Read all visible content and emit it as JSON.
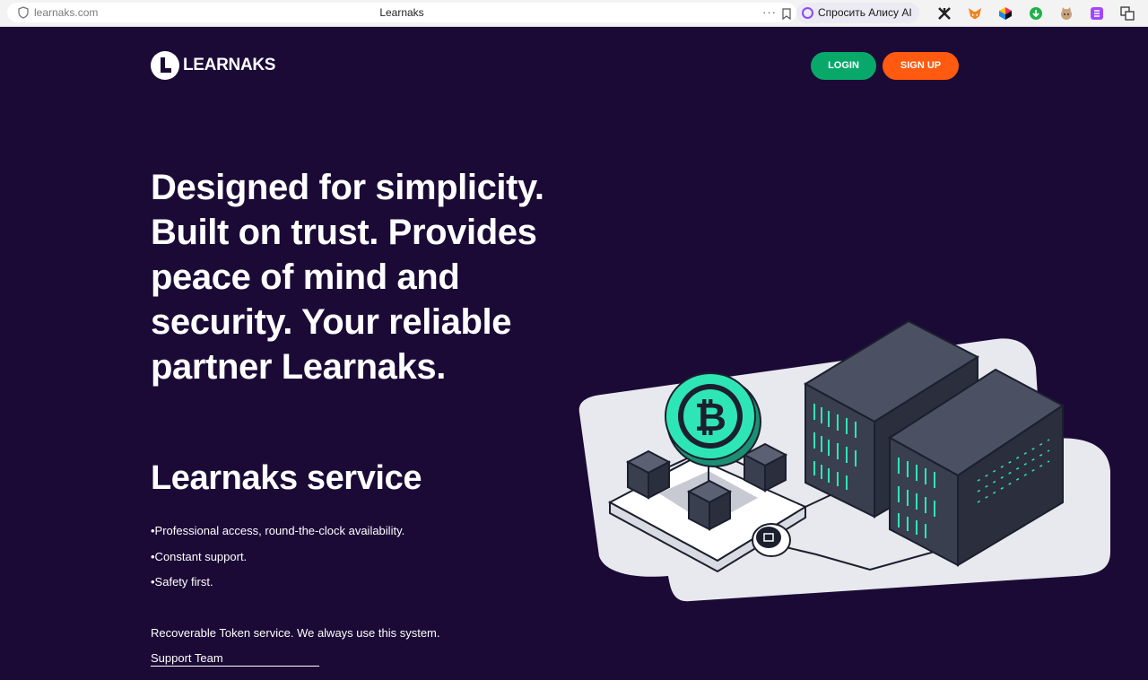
{
  "browser": {
    "url": "learnaks.com",
    "tab_title": "Learnaks",
    "more_glyph": "···",
    "alice_label": "Спросить Алису AI"
  },
  "header": {
    "logo_text": "LEARNAKS",
    "login_label": "LOGIN",
    "signup_label": "SIGN UP"
  },
  "hero": {
    "headline": "Designed for simplicity. Built on trust. Provides peace of mind and security. Your reliable partner Learnaks.",
    "service_title": "Learnaks service",
    "features": [
      "•Professional access, round-the-clock availability.",
      "•Constant support.",
      "•Safety first."
    ],
    "note": "Recoverable Token service. We always use this system.",
    "support_link": "Support Team"
  },
  "colors": {
    "background": "#1b0a36",
    "login": "#08a86a",
    "signup": "#ff5a0f",
    "accent_coin": "#2ee6b5"
  }
}
